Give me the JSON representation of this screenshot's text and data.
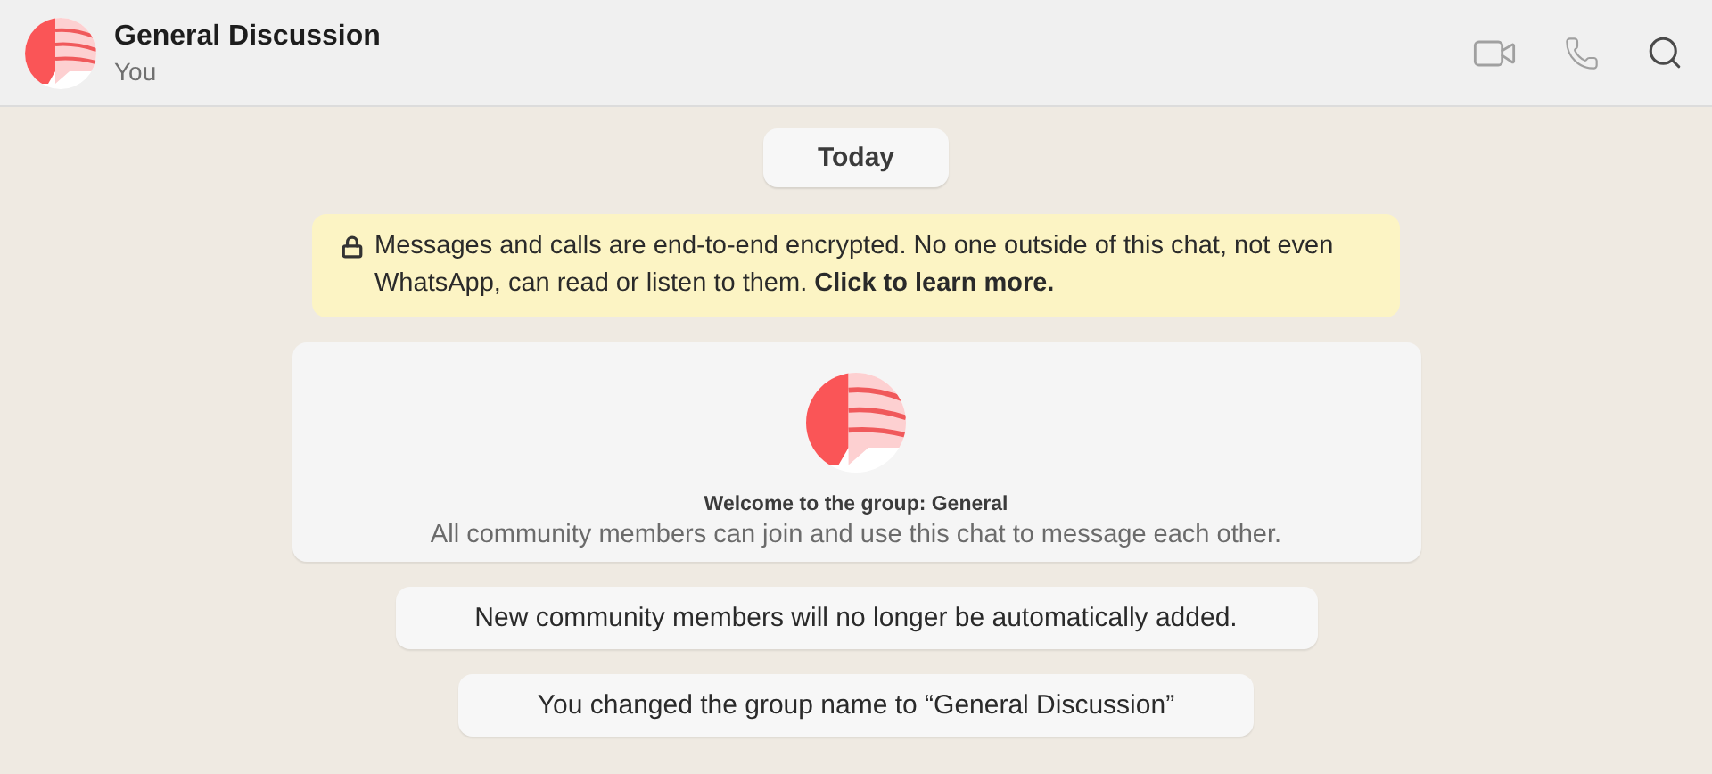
{
  "header": {
    "title": "General Discussion",
    "subtitle": "You"
  },
  "date_chip": "Today",
  "encryption_notice": "Messages and calls are end-to-end encrypted. No one outside of this chat, not even WhatsApp, can read or listen to them. **Click to learn more.**",
  "welcome_card": {
    "title": "Welcome to the group: General",
    "text": "All community members can join and use this chat to message each other."
  },
  "system_messages": [
    "New community members will no longer be automatically added.",
    "You changed the group name to “General Discussion”"
  ]
}
